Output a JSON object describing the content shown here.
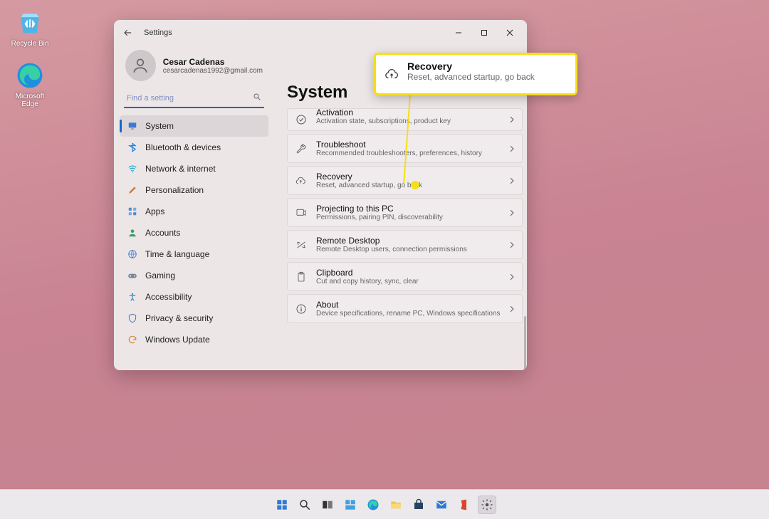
{
  "desktop": {
    "recycle_label": "Recycle Bin",
    "edge_label": "Microsoft Edge"
  },
  "window": {
    "title": "Settings"
  },
  "account": {
    "name": "Cesar Cadenas",
    "email": "cesarcadenas1992@gmail.com"
  },
  "search": {
    "placeholder": "Find a setting"
  },
  "sidebar": {
    "items": [
      {
        "label": "System",
        "icon": "monitor-icon",
        "active": true
      },
      {
        "label": "Bluetooth & devices",
        "icon": "bluetooth-icon",
        "active": false
      },
      {
        "label": "Network & internet",
        "icon": "wifi-icon",
        "active": false
      },
      {
        "label": "Personalization",
        "icon": "brush-icon",
        "active": false
      },
      {
        "label": "Apps",
        "icon": "apps-icon",
        "active": false
      },
      {
        "label": "Accounts",
        "icon": "person-icon",
        "active": false
      },
      {
        "label": "Time & language",
        "icon": "globe-icon",
        "active": false
      },
      {
        "label": "Gaming",
        "icon": "game-icon",
        "active": false
      },
      {
        "label": "Accessibility",
        "icon": "accessibility-icon",
        "active": false
      },
      {
        "label": "Privacy & security",
        "icon": "shield-icon",
        "active": false
      },
      {
        "label": "Windows Update",
        "icon": "update-icon",
        "active": false
      }
    ]
  },
  "page_heading": "System",
  "cards": [
    {
      "title": "Activation",
      "sub": "Activation state, subscriptions, product key",
      "icon": "check-circle-icon",
      "cut": true
    },
    {
      "title": "Troubleshoot",
      "sub": "Recommended troubleshooters, preferences, history",
      "icon": "wrench-icon"
    },
    {
      "title": "Recovery",
      "sub": "Reset, advanced startup, go back",
      "icon": "recovery-icon"
    },
    {
      "title": "Projecting to this PC",
      "sub": "Permissions, pairing PIN, discoverability",
      "icon": "projector-icon"
    },
    {
      "title": "Remote Desktop",
      "sub": "Remote Desktop users, connection permissions",
      "icon": "remote-icon"
    },
    {
      "title": "Clipboard",
      "sub": "Cut and copy history, sync, clear",
      "icon": "clipboard-icon"
    },
    {
      "title": "About",
      "sub": "Device specifications, rename PC, Windows specifications",
      "icon": "info-icon"
    }
  ],
  "callout": {
    "title": "Recovery",
    "sub": "Reset, advanced startup, go back"
  },
  "taskbar": {
    "items": [
      "start-icon",
      "search-icon",
      "taskview-icon",
      "widgets-icon",
      "edge-icon",
      "explorer-icon",
      "store-icon",
      "mail-icon",
      "office-icon",
      "settings-icon"
    ],
    "active": "settings-icon"
  }
}
